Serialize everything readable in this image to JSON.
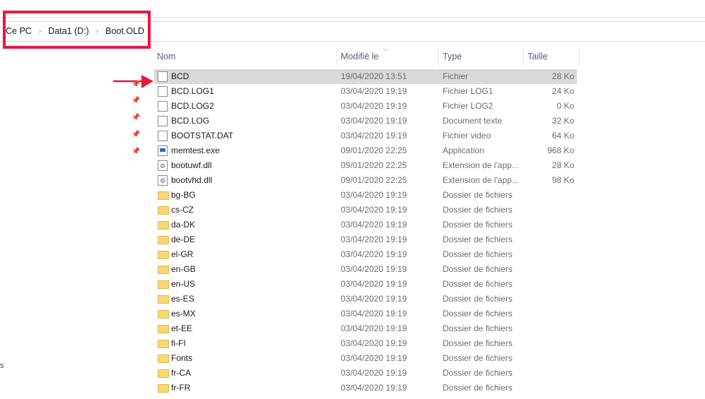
{
  "breadcrumb": [
    "Ce PC",
    "Data1 (D:)",
    "Boot.OLD"
  ],
  "columns": {
    "name": "Nom",
    "modified": "Modifié le",
    "type": "Type",
    "size": "Taille"
  },
  "files": [
    {
      "name": "BCD",
      "date": "19/04/2020 13:51",
      "type": "Fichier",
      "size": "28 Ko",
      "icon": "file",
      "selected": true
    },
    {
      "name": "BCD.LOG1",
      "date": "03/04/2020 19:19",
      "type": "Fichier LOG1",
      "size": "24 Ko",
      "icon": "file"
    },
    {
      "name": "BCD.LOG2",
      "date": "03/04/2020 19:19",
      "type": "Fichier LOG2",
      "size": "0 Ko",
      "icon": "file"
    },
    {
      "name": "BCD.LOG",
      "date": "03/04/2020 19:19",
      "type": "Document texte",
      "size": "32 Ko",
      "icon": "file"
    },
    {
      "name": "BOOTSTAT.DAT",
      "date": "03/04/2020 19:19",
      "type": "Fichier video",
      "size": "64 Ko",
      "icon": "file"
    },
    {
      "name": "memtest.exe",
      "date": "09/01/2020 22:25",
      "type": "Application",
      "size": "968 Ko",
      "icon": "app"
    },
    {
      "name": "bootuwf.dll",
      "date": "09/01/2020 22:25",
      "type": "Extension de l'app...",
      "size": "28 Ko",
      "icon": "dll"
    },
    {
      "name": "bootvhd.dll",
      "date": "09/01/2020 22:25",
      "type": "Extension de l'app...",
      "size": "98 Ko",
      "icon": "dll"
    },
    {
      "name": "bg-BG",
      "date": "03/04/2020 19:19",
      "type": "Dossier de fichiers",
      "size": "",
      "icon": "folder"
    },
    {
      "name": "cs-CZ",
      "date": "03/04/2020 19:19",
      "type": "Dossier de fichiers",
      "size": "",
      "icon": "folder"
    },
    {
      "name": "da-DK",
      "date": "03/04/2020 19:19",
      "type": "Dossier de fichiers",
      "size": "",
      "icon": "folder"
    },
    {
      "name": "de-DE",
      "date": "03/04/2020 19:19",
      "type": "Dossier de fichiers",
      "size": "",
      "icon": "folder"
    },
    {
      "name": "el-GR",
      "date": "03/04/2020 19:19",
      "type": "Dossier de fichiers",
      "size": "",
      "icon": "folder"
    },
    {
      "name": "en-GB",
      "date": "03/04/2020 19:19",
      "type": "Dossier de fichiers",
      "size": "",
      "icon": "folder"
    },
    {
      "name": "en-US",
      "date": "03/04/2020 19:19",
      "type": "Dossier de fichiers",
      "size": "",
      "icon": "folder"
    },
    {
      "name": "es-ES",
      "date": "03/04/2020 19:19",
      "type": "Dossier de fichiers",
      "size": "",
      "icon": "folder"
    },
    {
      "name": "es-MX",
      "date": "03/04/2020 19:19",
      "type": "Dossier de fichiers",
      "size": "",
      "icon": "folder"
    },
    {
      "name": "et-EE",
      "date": "03/04/2020 19:19",
      "type": "Dossier de fichiers",
      "size": "",
      "icon": "folder"
    },
    {
      "name": "fi-FI",
      "date": "03/04/2020 19:19",
      "type": "Dossier de fichiers",
      "size": "",
      "icon": "folder"
    },
    {
      "name": "Fonts",
      "date": "03/04/2020 19:19",
      "type": "Dossier de fichiers",
      "size": "",
      "icon": "folder"
    },
    {
      "name": "fr-CA",
      "date": "03/04/2020 19:19",
      "type": "Dossier de fichiers",
      "size": "",
      "icon": "folder"
    },
    {
      "name": "fr-FR",
      "date": "03/04/2020 19:19",
      "type": "Dossier de fichiers",
      "size": "",
      "icon": "folder"
    }
  ],
  "sidebar_stray_text": "s",
  "colors": {
    "highlight": "#e8173f",
    "selected_row": "#d9d9d9",
    "header_text": "#4c607a"
  }
}
